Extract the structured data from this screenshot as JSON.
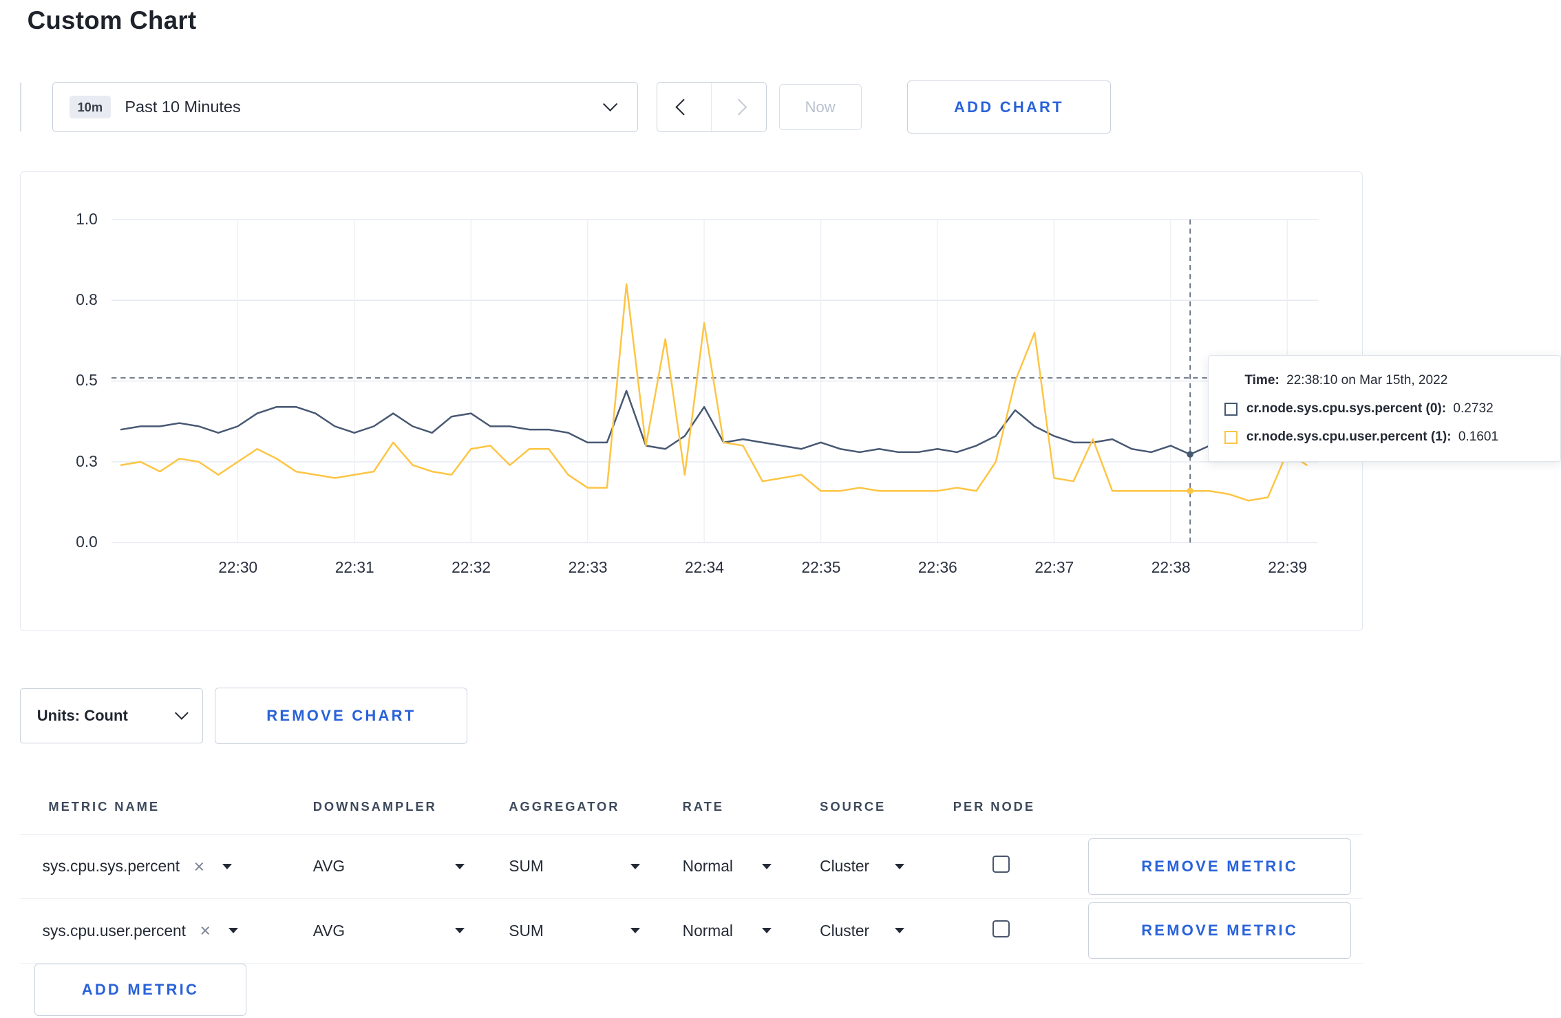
{
  "page": {
    "title": "Custom Chart"
  },
  "toolbar": {
    "time_range": {
      "badge": "10m",
      "label": "Past 10 Minutes"
    },
    "now_label": "Now",
    "add_chart_label": "ADD CHART"
  },
  "chart_controls": {
    "units_label": "Units: Count",
    "remove_chart_label": "REMOVE CHART"
  },
  "tooltip": {
    "time_label": "Time:",
    "time_value": "22:38:10 on Mar 15th, 2022",
    "series": [
      {
        "label": "cr.node.sys.cpu.sys.percent (0):",
        "value": "0.2732",
        "color": "#475872"
      },
      {
        "label": "cr.node.sys.cpu.user.percent (1):",
        "value": "0.1601",
        "color": "#fdc544"
      }
    ]
  },
  "metrics_table": {
    "headers": [
      "METRIC NAME",
      "DOWNSAMPLER",
      "AGGREGATOR",
      "RATE",
      "SOURCE",
      "PER NODE"
    ],
    "remove_metric_label": "REMOVE METRIC",
    "add_metric_label": "ADD METRIC",
    "rows": [
      {
        "metric": "sys.cpu.sys.percent",
        "downsampler": "AVG",
        "aggregator": "SUM",
        "rate": "Normal",
        "source": "Cluster",
        "per_node": false
      },
      {
        "metric": "sys.cpu.user.percent",
        "downsampler": "AVG",
        "aggregator": "SUM",
        "rate": "Normal",
        "source": "Cluster",
        "per_node": false
      }
    ]
  },
  "chart_data": {
    "type": "line",
    "title": "",
    "xlabel": "",
    "ylabel": "",
    "ylim": [
      0,
      1
    ],
    "legend_position": "none",
    "grid": true,
    "x_ticks": [
      "22:30",
      "22:31",
      "22:32",
      "22:33",
      "22:34",
      "22:35",
      "22:36",
      "22:37",
      "22:38",
      "22:39"
    ],
    "y_ticks": [
      {
        "value": 0,
        "label": "0.0"
      },
      {
        "value": 0.25,
        "label": "0.3"
      },
      {
        "value": 0.5,
        "label": "0.5"
      },
      {
        "value": 0.75,
        "label": "0.8"
      },
      {
        "value": 1.0,
        "label": "1.0"
      }
    ],
    "sample_interval_seconds": 10,
    "series": [
      {
        "name": "cr.node.sys.cpu.sys.percent",
        "color": "#475872",
        "values": [
          0.35,
          0.36,
          0.36,
          0.37,
          0.36,
          0.34,
          0.36,
          0.4,
          0.42,
          0.42,
          0.4,
          0.36,
          0.34,
          0.36,
          0.4,
          0.36,
          0.34,
          0.39,
          0.4,
          0.36,
          0.36,
          0.35,
          0.35,
          0.34,
          0.31,
          0.31,
          0.47,
          0.3,
          0.29,
          0.33,
          0.42,
          0.31,
          0.32,
          0.31,
          0.3,
          0.29,
          0.31,
          0.29,
          0.28,
          0.29,
          0.28,
          0.28,
          0.29,
          0.28,
          0.3,
          0.33,
          0.41,
          0.36,
          0.33,
          0.31,
          0.31,
          0.32,
          0.29,
          0.28,
          0.3,
          0.2732,
          0.3,
          0.29,
          0.31,
          0.3,
          0.3,
          0.31
        ]
      },
      {
        "name": "cr.node.sys.cpu.user.percent",
        "color": "#fdc544",
        "values": [
          0.24,
          0.25,
          0.22,
          0.26,
          0.25,
          0.21,
          0.25,
          0.29,
          0.26,
          0.22,
          0.21,
          0.2,
          0.21,
          0.22,
          0.31,
          0.24,
          0.22,
          0.21,
          0.29,
          0.3,
          0.24,
          0.29,
          0.29,
          0.21,
          0.17,
          0.17,
          0.8,
          0.3,
          0.63,
          0.21,
          0.68,
          0.31,
          0.3,
          0.19,
          0.2,
          0.21,
          0.16,
          0.16,
          0.17,
          0.16,
          0.16,
          0.16,
          0.16,
          0.17,
          0.16,
          0.25,
          0.5,
          0.65,
          0.2,
          0.19,
          0.32,
          0.16,
          0.16,
          0.16,
          0.16,
          0.1601,
          0.16,
          0.15,
          0.13,
          0.14,
          0.28,
          0.24
        ]
      }
    ],
    "crosshair": {
      "x_index": 55,
      "time": "22:38:10",
      "y_value": 0.51
    }
  }
}
